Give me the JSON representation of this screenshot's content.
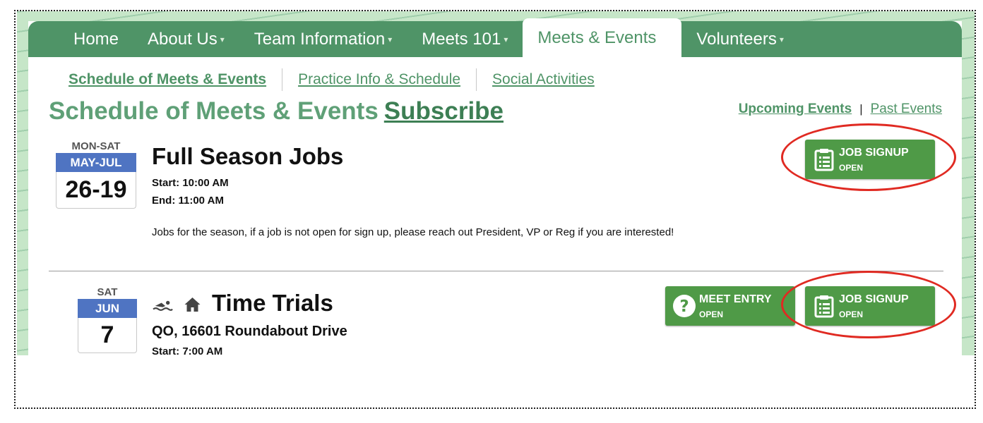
{
  "nav": {
    "items": [
      {
        "label": "Home",
        "caret": ""
      },
      {
        "label": "About Us",
        "caret": "▾"
      },
      {
        "label": "Team Information",
        "caret": "▾"
      },
      {
        "label": "Meets 101",
        "caret": "▾"
      },
      {
        "label": "Meets & Events",
        "caret": ""
      },
      {
        "label": "Volunteers",
        "caret": "▾"
      }
    ],
    "active": "Meets & Events"
  },
  "subnav": {
    "items": [
      {
        "label": "Schedule of Meets & Events"
      },
      {
        "label": "Practice Info & Schedule"
      },
      {
        "label": "Social Activities"
      }
    ]
  },
  "page": {
    "title": "Schedule of Meets & Events",
    "subscribe_label": "Subscribe",
    "upcoming_label": "Upcoming Events",
    "separator": "|",
    "past_label": "Past Events"
  },
  "events": [
    {
      "dow": "MON-SAT",
      "month": "MAY-JUL",
      "day": "26-19",
      "title": "Full Season Jobs",
      "start": "Start: 10:00 AM",
      "end": "End: 11:00 AM",
      "description": "Jobs for the season, if a job is not open for sign up, please reach out President, VP or Reg if you are interested!",
      "buttons": [
        {
          "label": "JOB SIGNUP",
          "status": "OPEN",
          "icon": "clipboard-icon"
        }
      ]
    },
    {
      "dow": "SAT",
      "month": "JUN",
      "day": "7",
      "title": "Time Trials",
      "location": "QO, 16601 Roundabout Drive",
      "start": "Start: 7:00 AM",
      "icons": [
        "swimmer-icon",
        "home-icon"
      ],
      "buttons": [
        {
          "label": "MEET ENTRY",
          "status": "OPEN",
          "icon": "question-icon"
        },
        {
          "label": "JOB SIGNUP",
          "status": "OPEN",
          "icon": "clipboard-icon"
        }
      ]
    }
  ],
  "colors": {
    "brand_green": "#4f9467",
    "title_green": "#5fa077",
    "button_green": "#4f9a47",
    "calendar_blue": "#4f74c2",
    "highlight_red": "#e02a22"
  }
}
